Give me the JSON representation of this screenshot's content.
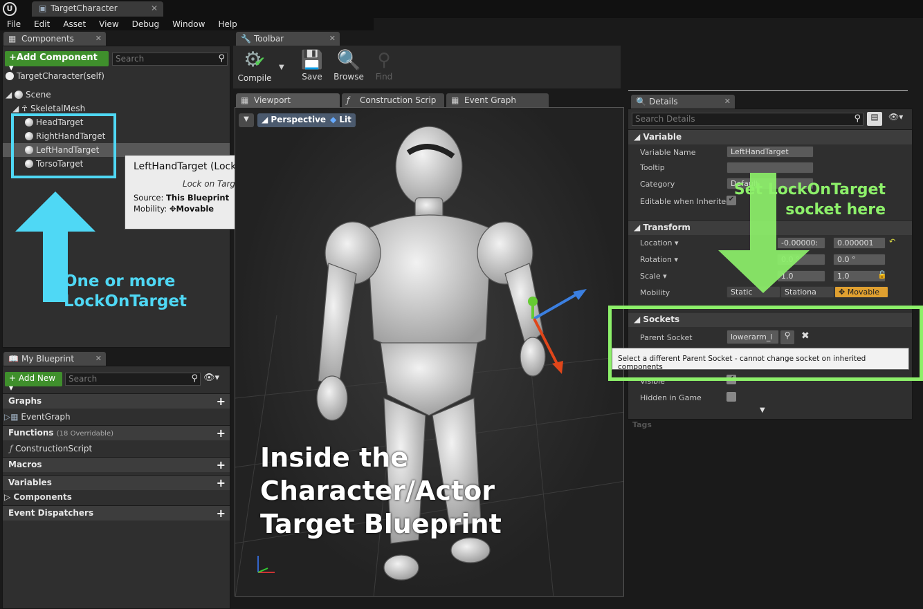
{
  "window": {
    "logo": "U",
    "tab_title": "TargetCharacter",
    "tab_close": "✕"
  },
  "menu": [
    "File",
    "Edit",
    "Asset",
    "View",
    "Debug",
    "Window",
    "Help"
  ],
  "components_panel": {
    "tab": "Components",
    "add_button": "+Add Component",
    "search_placeholder": "Search",
    "self_item": "TargetCharacter(self)",
    "tree": {
      "scene": "Scene",
      "mesh": "SkeletalMesh",
      "targets": [
        "HeadTarget",
        "RightHandTarget",
        "LeftHandTarget",
        "TorsoTarget"
      ]
    }
  },
  "tooltip": {
    "title": "LeftHandTarget (Lock on Target)",
    "subtitle": "Lock on Target",
    "source_label": "Source:",
    "source_value": "This Blueprint",
    "mobility_label": "Mobility:",
    "mobility_value": "Movable"
  },
  "annotations": {
    "left": [
      "One or more",
      "LockOnTarget"
    ],
    "right": [
      "Set LockOnTarget",
      "socket here"
    ],
    "viewport": [
      "Inside the",
      "Character/Actor",
      "Target Blueprint"
    ]
  },
  "toolbar": {
    "tab": "Toolbar",
    "buttons": [
      "Compile",
      "Save",
      "Browse",
      "Find"
    ]
  },
  "editor_tabs": [
    "Viewport",
    "Construction Scrip",
    "Event Graph"
  ],
  "viewport": {
    "perspective": "Perspective",
    "lit": "Lit"
  },
  "my_blueprint": {
    "tab": "My Blueprint",
    "add_new": "+ Add New",
    "search_placeholder": "Search",
    "graphs": "Graphs",
    "event_graph": "EventGraph",
    "functions": "Functions",
    "functions_note": "(18 Overridable)",
    "construction_script": "ConstructionScript",
    "macros": "Macros",
    "variables": "Variables",
    "components": "Components",
    "event_dispatchers": "Event Dispatchers"
  },
  "details": {
    "tab": "Details",
    "search_placeholder": "Search Details",
    "variable_section": "Variable",
    "variable_name_label": "Variable Name",
    "variable_name_value": "LeftHandTarget",
    "tooltip_label": "Tooltip",
    "category_label": "Category",
    "category_value": "Default",
    "editable_label": "Editable when Inherited",
    "transform_section": "Transform",
    "location_label": "Location",
    "location_y": "-0.00000:",
    "location_z": "0.000001",
    "rotation_label": "Rotation",
    "rotation_y": "0.0 °",
    "rotation_z": "0.0 °",
    "scale_label": "Scale",
    "scale_y": "1.0",
    "scale_z": "1.0",
    "mobility_label": "Mobility",
    "mob_static": "Static",
    "mob_stationary": "Stationa",
    "mob_movable": "Movable",
    "sockets_section": "Sockets",
    "parent_socket_label": "Parent Socket",
    "parent_socket_value": "lowerarm_l",
    "socket_tooltip": "Select a different Parent Socket - cannot change socket on inherited components",
    "visible_label": "Visible",
    "hidden_label": "Hidden in Game",
    "tags_section": "Tags"
  },
  "colors": {
    "cyan": "#4fd8f5",
    "green": "#8df06a",
    "add_green": "#3f8f2c"
  }
}
